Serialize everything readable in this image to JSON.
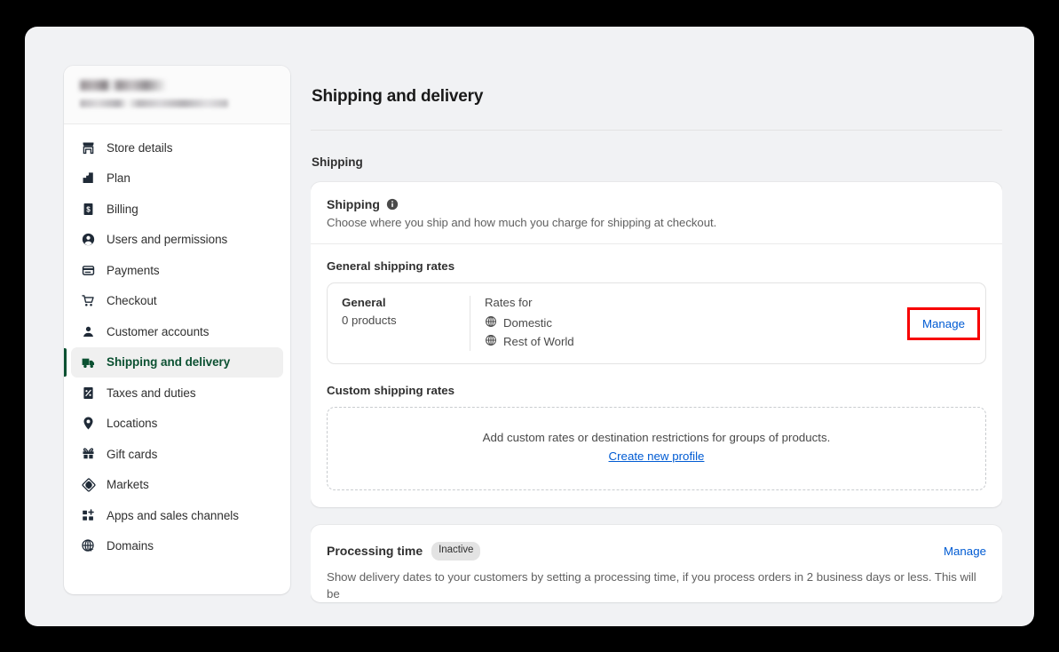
{
  "sidebar": {
    "store_name_redacted": "",
    "store_domain_redacted": "",
    "items": [
      {
        "label": "Store details",
        "icon": "store-icon",
        "selected": false
      },
      {
        "label": "Plan",
        "icon": "plan-steps-icon",
        "selected": false
      },
      {
        "label": "Billing",
        "icon": "billing-receipt-icon",
        "selected": false
      },
      {
        "label": "Users and permissions",
        "icon": "user-circle-icon",
        "selected": false
      },
      {
        "label": "Payments",
        "icon": "payments-card-icon",
        "selected": false
      },
      {
        "label": "Checkout",
        "icon": "cart-icon",
        "selected": false
      },
      {
        "label": "Customer accounts",
        "icon": "person-icon",
        "selected": false
      },
      {
        "label": "Shipping and delivery",
        "icon": "truck-icon",
        "selected": true
      },
      {
        "label": "Taxes and duties",
        "icon": "tax-percent-icon",
        "selected": false
      },
      {
        "label": "Locations",
        "icon": "map-pin-icon",
        "selected": false
      },
      {
        "label": "Gift cards",
        "icon": "gift-icon",
        "selected": false
      },
      {
        "label": "Markets",
        "icon": "markets-globe-icon",
        "selected": false
      },
      {
        "label": "Apps and sales channels",
        "icon": "apps-grid-plus-icon",
        "selected": false
      },
      {
        "label": "Domains",
        "icon": "domains-globe-icon",
        "selected": false
      }
    ]
  },
  "main": {
    "page_title": "Shipping and delivery",
    "section_heading": "Shipping",
    "shipping_card": {
      "title": "Shipping",
      "info_icon": "info-icon",
      "subtitle": "Choose where you ship and how much you charge for shipping at checkout.",
      "general_rates_label": "General shipping rates",
      "profile": {
        "name": "General",
        "products": "0 products",
        "rates_for_label": "Rates for",
        "zones": [
          {
            "label": "Domestic",
            "icon": "globe-icon"
          },
          {
            "label": "Rest of World",
            "icon": "globe-icon"
          }
        ],
        "manage_label": "Manage"
      },
      "custom_rates_label": "Custom shipping rates",
      "custom_empty_text": "Add custom rates or destination restrictions for groups of products.",
      "create_profile_label": "Create new profile"
    },
    "processing_card": {
      "title": "Processing time",
      "badge": "Inactive",
      "manage_label": "Manage",
      "description": "Show delivery dates to your customers by setting a processing time, if you process orders in 2 business days or less. This will be"
    }
  },
  "colors": {
    "accent_green": "#0c5132",
    "link_blue": "#005bd3",
    "annotation_red": "#f70000",
    "page_bg": "#f1f2f4"
  }
}
